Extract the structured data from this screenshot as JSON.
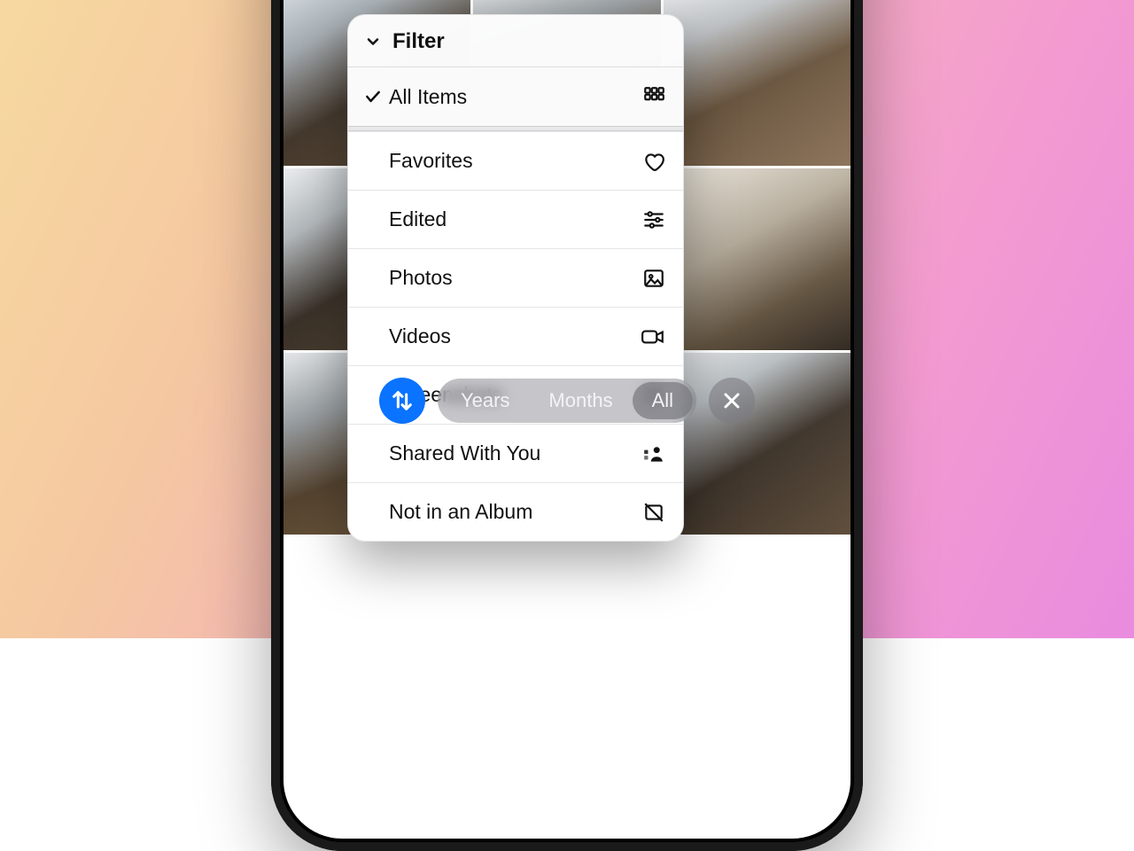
{
  "filter_menu": {
    "title": "Filter",
    "selected": "All Items",
    "options": [
      {
        "label": "All Items",
        "icon": "grid-icon",
        "checked": true
      },
      {
        "label": "Favorites",
        "icon": "heart-icon",
        "checked": false
      },
      {
        "label": "Edited",
        "icon": "sliders-icon",
        "checked": false
      },
      {
        "label": "Photos",
        "icon": "photo-icon",
        "checked": false
      },
      {
        "label": "Videos",
        "icon": "video-icon",
        "checked": false
      },
      {
        "label": "Screenshots",
        "icon": "screenshot-icon",
        "checked": false
      },
      {
        "label": "Shared With You",
        "icon": "shared-icon",
        "checked": false
      },
      {
        "label": "Not in an Album",
        "icon": "no-album-icon",
        "checked": false
      }
    ]
  },
  "toolbar": {
    "sort_button": "Sort",
    "segments": {
      "years": "Years",
      "months": "Months",
      "all": "All"
    },
    "active_segment": "All",
    "close_button": "Close"
  }
}
